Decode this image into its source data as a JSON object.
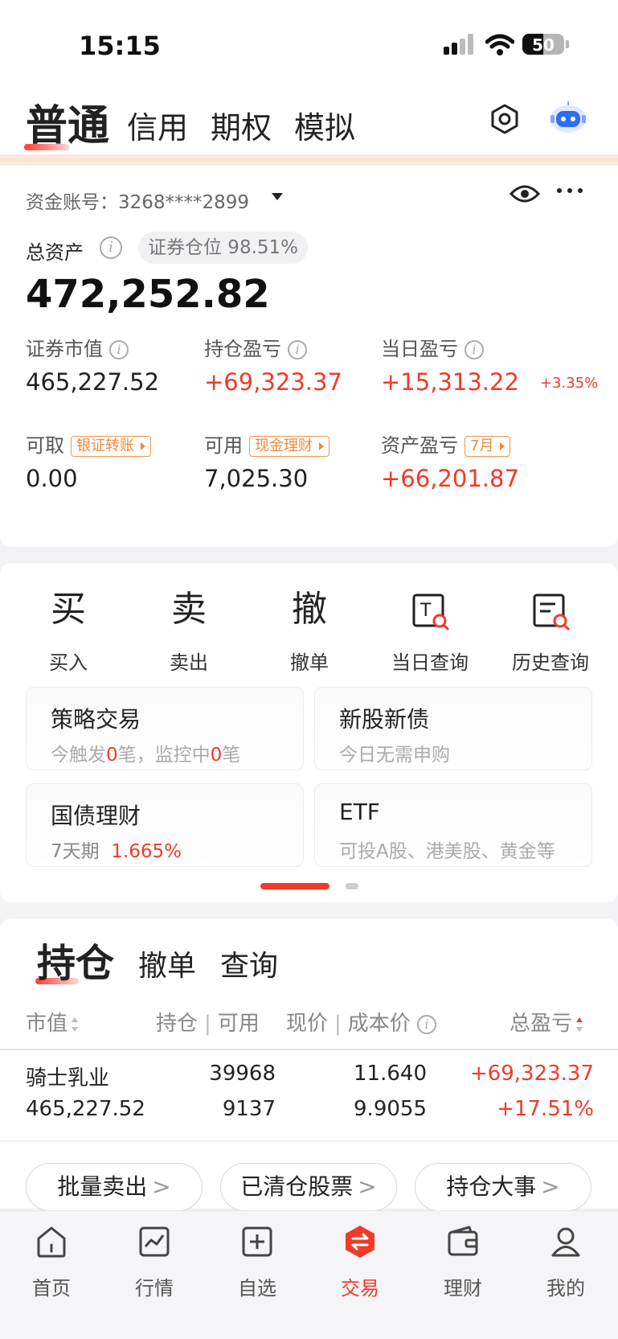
{
  "status_bar": {
    "time": "15:15",
    "battery": "50"
  },
  "top_tabs": [
    "普通",
    "信用",
    "期权",
    "模拟"
  ],
  "account": {
    "account_label": "资金账号：3268****2899",
    "total_label": "总资产",
    "position_pill": "证券仓位 98.51%",
    "total_value": "472,252.82",
    "metrics": [
      {
        "label": "证券市值",
        "value": "465,227.52"
      },
      {
        "label": "持仓盈亏",
        "value": "+69,323.37"
      },
      {
        "label": "当日盈亏",
        "value": "+15,313.22",
        "extra": "+3.35%"
      },
      {
        "label": "可取",
        "tag": "银证转账",
        "value": "0.00"
      },
      {
        "label": "可用",
        "tag": "现金理财",
        "value": "7,025.30"
      },
      {
        "label": "资产盈亏",
        "tag": "7月",
        "value": "+66,201.87"
      }
    ]
  },
  "actions": [
    {
      "glyph": "买",
      "label": "买入"
    },
    {
      "glyph": "卖",
      "label": "卖出"
    },
    {
      "glyph": "撤",
      "label": "撤单"
    },
    {
      "label": "当日查询"
    },
    {
      "label": "历史查询"
    }
  ],
  "boxes": {
    "strategy": {
      "title": "策略交易",
      "s1": "今触发",
      "n1": "0",
      "s2": "笔，监控中",
      "n2": "0",
      "s3": "笔"
    },
    "ipo": {
      "title": "新股新债",
      "sub": "今日无需申购"
    },
    "bond": {
      "title": "国债理财",
      "sub1": "7天期",
      "sub2": "1.665%"
    },
    "etf": {
      "title": "ETF",
      "sub": "可投A股、港美股、黄金等"
    }
  },
  "holdings": {
    "tabs": [
      "持仓",
      "撤单",
      "查询"
    ],
    "headers": {
      "market": "市值",
      "qty": "持仓",
      "avail": "可用",
      "price": "现价",
      "cost": "成本价",
      "pnl": "总盈亏"
    },
    "row": {
      "name": "骑士乳业",
      "market_value": "465,227.52",
      "qty": "39968",
      "avail": "9137",
      "price": "11.640",
      "cost": "9.9055",
      "pnl": "+69,323.37",
      "pnl_pct": "+17.51%"
    },
    "buttons": [
      "批量卖出",
      "已清仓股票",
      "持仓大事"
    ]
  },
  "bottom_nav": [
    "首页",
    "行情",
    "自选",
    "交易",
    "理财",
    "我的"
  ],
  "colors": {
    "accent": "#f03b2a",
    "tag": "#f08a35"
  }
}
